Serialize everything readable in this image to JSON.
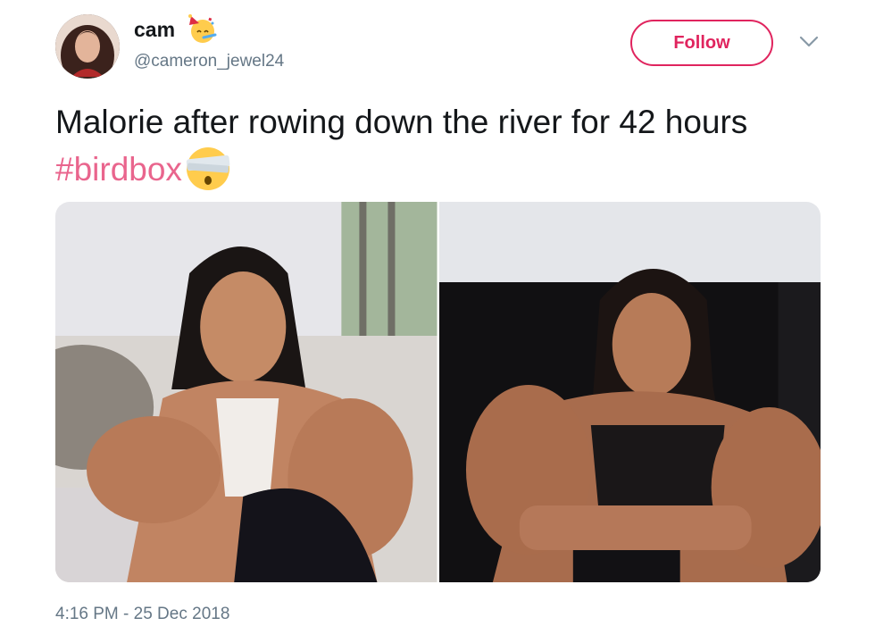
{
  "tweet": {
    "display_name": "cam",
    "handle": "@cameron_jewel24",
    "follow_label": "Follow",
    "text_main": "Malorie after rowing down the river for 42 hours ",
    "hashtag": "#birdbox",
    "timestamp": "4:16 PM - 25 Dec 2018",
    "accent_color": "#e0245e",
    "icons": [
      "party-face-emoji",
      "chevron-down-icon",
      "blindfolded-face-emoji"
    ],
    "media_count": 2
  }
}
